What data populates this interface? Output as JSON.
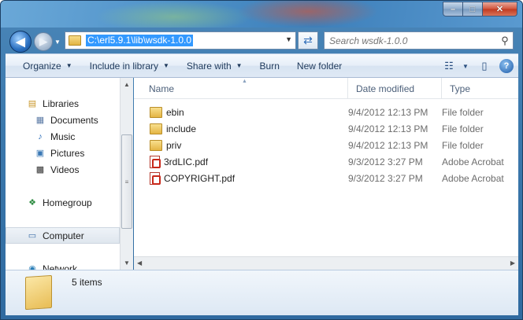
{
  "window": {
    "caption": {
      "minimize": "–",
      "maximize": "□",
      "close": "✕"
    }
  },
  "nav": {
    "address_path": "C:\\erl5.9.1\\lib\\wsdk-1.0.0",
    "search_placeholder": "Search wsdk-1.0.0"
  },
  "toolbar": {
    "organize": "Organize",
    "include_in_library": "Include in library",
    "share_with": "Share with",
    "burn": "Burn",
    "new_folder": "New folder"
  },
  "sidebar": {
    "items": [
      {
        "label": "Libraries",
        "icon": "libraries-icon"
      },
      {
        "label": "Documents",
        "icon": "documents-icon"
      },
      {
        "label": "Music",
        "icon": "music-icon"
      },
      {
        "label": "Pictures",
        "icon": "pictures-icon"
      },
      {
        "label": "Videos",
        "icon": "videos-icon"
      },
      {
        "label": "Homegroup",
        "icon": "homegroup-icon"
      },
      {
        "label": "Computer",
        "icon": "computer-icon"
      },
      {
        "label": "Network",
        "icon": "network-icon"
      }
    ]
  },
  "columns": {
    "name": "Name",
    "date": "Date modified",
    "type": "Type"
  },
  "files": [
    {
      "name": "ebin",
      "date": "9/4/2012 12:13 PM",
      "type": "File folder",
      "kind": "folder"
    },
    {
      "name": "include",
      "date": "9/4/2012 12:13 PM",
      "type": "File folder",
      "kind": "folder"
    },
    {
      "name": "priv",
      "date": "9/4/2012 12:13 PM",
      "type": "File folder",
      "kind": "folder"
    },
    {
      "name": "3rdLIC.pdf",
      "date": "9/3/2012 3:27 PM",
      "type": "Adobe Acrobat",
      "kind": "pdf"
    },
    {
      "name": "COPYRIGHT.pdf",
      "date": "9/3/2012 3:27 PM",
      "type": "Adobe Acrobat",
      "kind": "pdf"
    }
  ],
  "details": {
    "count": "5 items"
  }
}
